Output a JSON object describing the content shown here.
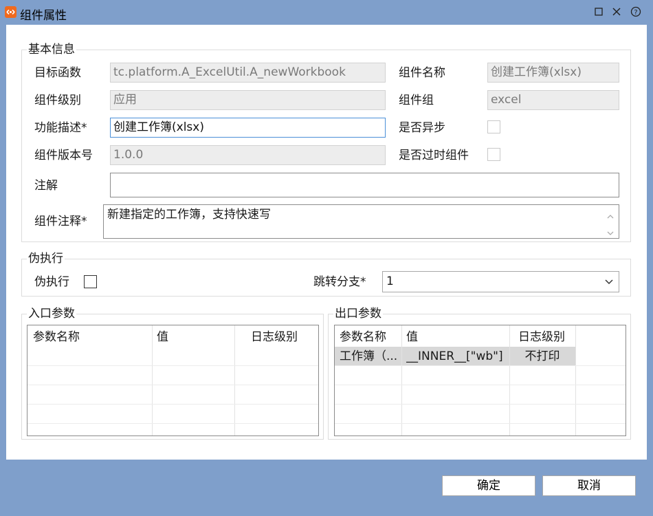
{
  "window": {
    "title": "组件属性",
    "icon": "component-app-icon",
    "controls": [
      "maximize-icon",
      "close-icon",
      "help-icon"
    ]
  },
  "basic_info": {
    "legend": "基本信息",
    "target_function": {
      "label": "目标函数",
      "value": "tc.platform.A_ExcelUtil.A_newWorkbook"
    },
    "component_name": {
      "label": "组件名称",
      "value": "创建工作簿(xlsx)"
    },
    "component_level": {
      "label": "组件级别",
      "value": "应用"
    },
    "component_group": {
      "label": "组件组",
      "value": "excel"
    },
    "description": {
      "label": "功能描述*",
      "value": "创建工作簿(xlsx)"
    },
    "is_async": {
      "label": "是否异步",
      "checked": false
    },
    "version": {
      "label": "组件版本号",
      "value": "1.0.0"
    },
    "is_deprecated": {
      "label": "是否过时组件",
      "checked": false
    },
    "annotation": {
      "label": "注解",
      "value": ""
    },
    "component_comment": {
      "label": "组件注释*",
      "value": "新建指定的工作簿，支持快速写"
    }
  },
  "pseudo_exec": {
    "legend": "伪执行",
    "checkbox_label": "伪执行",
    "checked": false,
    "jump_branch": {
      "label": "跳转分支*",
      "value": "1"
    }
  },
  "input_params": {
    "legend": "入口参数",
    "columns": [
      "参数名称",
      "值",
      "日志级别"
    ],
    "rows": []
  },
  "output_params": {
    "legend": "出口参数",
    "columns": [
      "参数名称",
      "值",
      "日志级别"
    ],
    "rows": [
      [
        "工作簿（...",
        "__INNER__[\"wb\"]",
        "不打印"
      ]
    ]
  },
  "buttons": {
    "ok": "确定",
    "cancel": "取消"
  }
}
